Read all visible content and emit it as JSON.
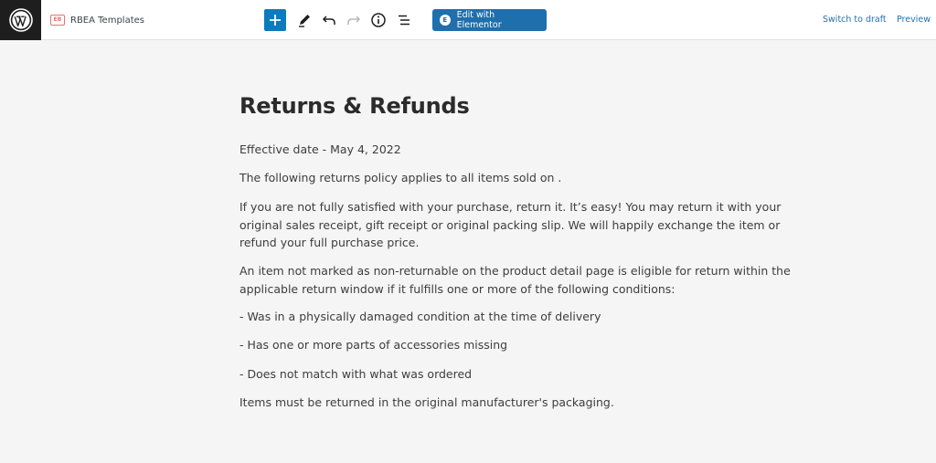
{
  "toolbar": {
    "template_name": "RBEA Templates",
    "template_badge": "EB",
    "edit_button_label": "Edit with Elementor",
    "edit_button_badge": "E",
    "switch_draft_label": "Switch to draft",
    "preview_label": "Preview",
    "icons": [
      "wordpress-logo-icon",
      "add-block-icon",
      "pencil-icon",
      "undo-icon",
      "redo-icon",
      "info-icon",
      "list-view-icon"
    ],
    "accent_color": "#0a7bbd",
    "button_color": "#1f6fac",
    "link_color": "#2271b1"
  },
  "post": {
    "title": "Returns & Refunds",
    "paragraphs": [
      "Effective date - May 4, 2022",
      "The following returns policy applies to all items sold on .",
      "If you are not fully satisfied with your purchase, return it. It’s easy! You may return it with your original sales receipt, gift receipt or original packing slip. We will happily exchange the item or refund your full purchase price.",
      "An item not marked as non-returnable on the product detail page is eligible for return within the applicable return window if it fulfills one or more of the following conditions:",
      "- Was in a physically damaged condition at the time of delivery",
      "- Has one or more parts of accessories missing",
      "- Does not match with what was ordered",
      "Items must be returned in the original manufacturer's packaging."
    ]
  }
}
